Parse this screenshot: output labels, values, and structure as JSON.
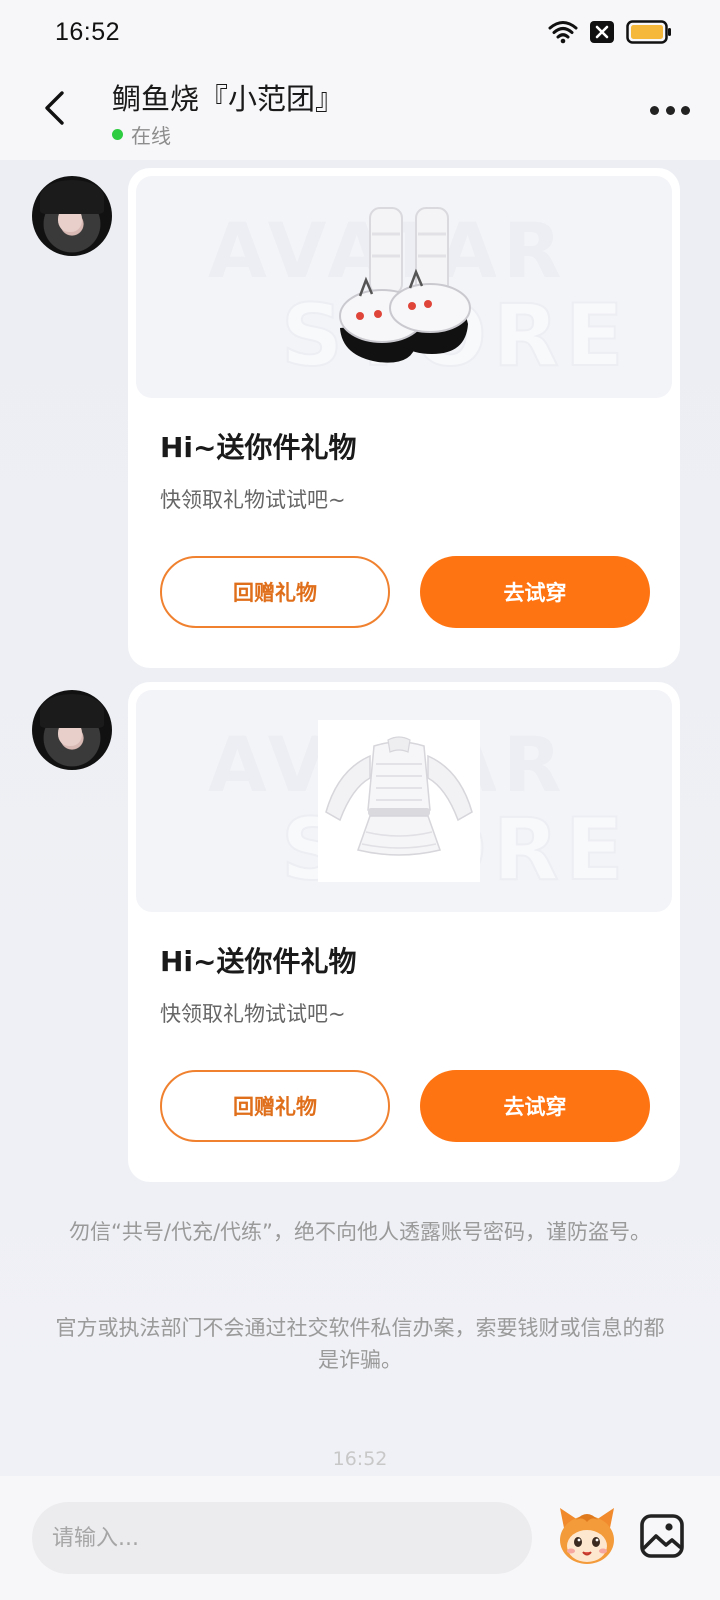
{
  "status_bar": {
    "time": "16:52"
  },
  "header": {
    "title": "鲷鱼烧『小范团』",
    "status": "在线"
  },
  "messages": [
    {
      "title": "Hi~送你件礼物",
      "subtitle": "快领取礼物试试吧~",
      "return_label": "回赠礼物",
      "try_label": "去试穿",
      "gift": "shoes"
    },
    {
      "title": "Hi~送你件礼物",
      "subtitle": "快领取礼物试试吧~",
      "return_label": "回赠礼物",
      "try_label": "去试穿",
      "gift": "top"
    }
  ],
  "notices": [
    "勿信“共号/代充/代练”，绝不向他人透露账号密码，谨防盗号。",
    "官方或执法部门不会通过社交软件私信办案，索要钱财或信息的都是诈骗。"
  ],
  "faded_time": "16:52",
  "input": {
    "placeholder": "请输入..."
  },
  "colors": {
    "accent": "#ff7412",
    "online": "#2ecc40",
    "battery": "#f5b83a"
  },
  "icons": [
    "wifi-icon",
    "sim-off-icon",
    "battery-icon",
    "back-arrow-icon",
    "more-dots-icon",
    "mascot-icon",
    "image-icon"
  ]
}
